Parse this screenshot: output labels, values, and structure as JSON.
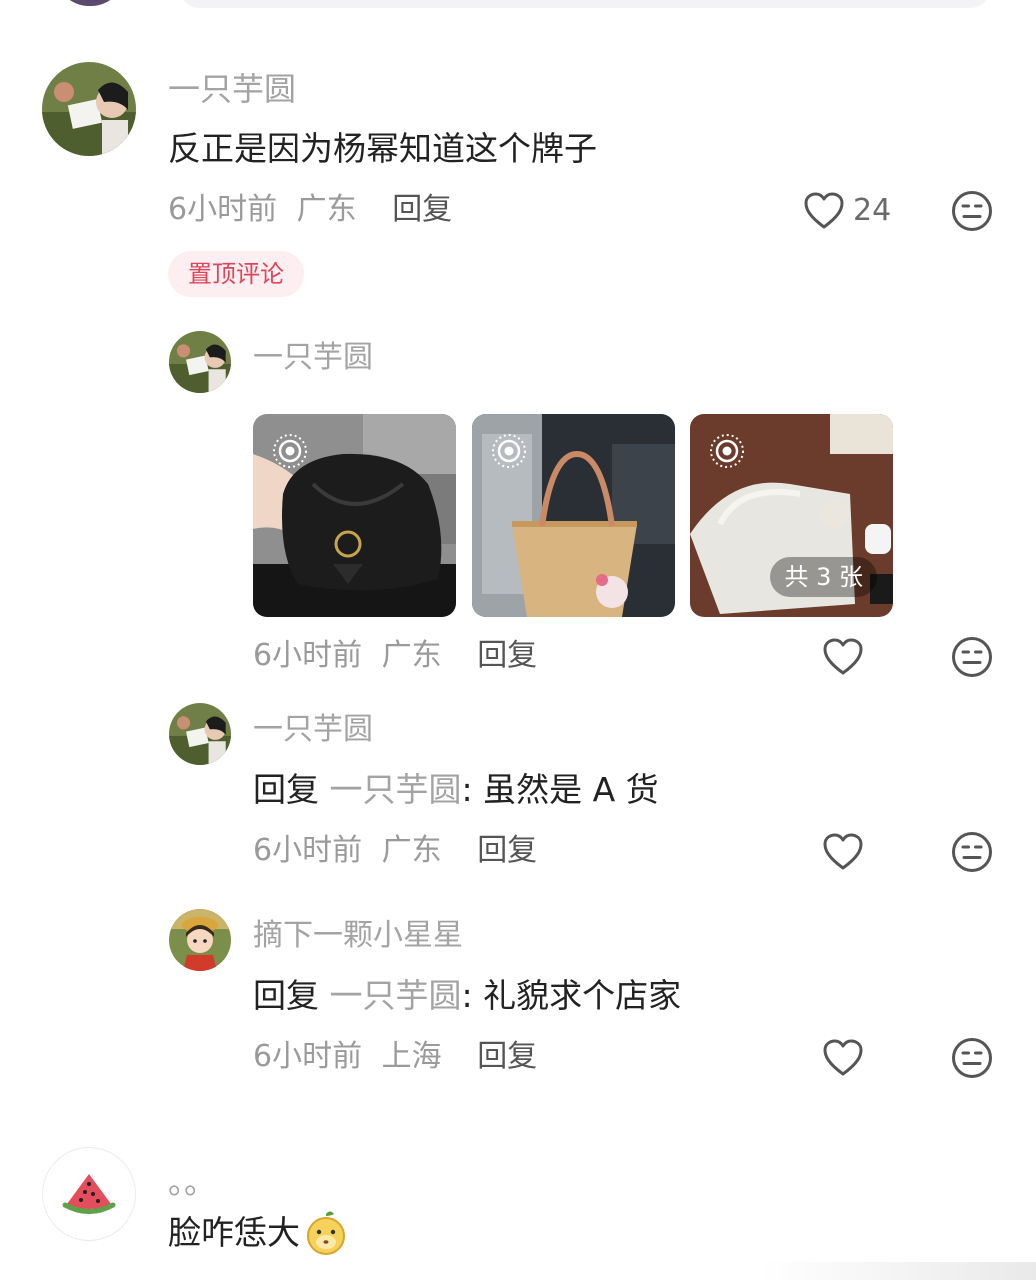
{
  "comments": {
    "main": {
      "username": "一只芋圆",
      "text": "反正是因为杨幂知道这个牌子",
      "time": "6小时前",
      "location": "广东",
      "reply_label": "回复",
      "likes": "24",
      "badge": "置顶评论"
    },
    "replies": [
      {
        "username": "一只芋圆",
        "images_badge": "共 3 张",
        "time": "6小时前",
        "location": "广东",
        "reply_label": "回复"
      },
      {
        "username": "一只芋圆",
        "prefix": "回复",
        "target": "一只芋圆",
        "text": ": 虽然是 A 货",
        "time": "6小时前",
        "location": "广东",
        "reply_label": "回复"
      },
      {
        "username": "摘下一颗小星星",
        "prefix": "回复",
        "target": "一只芋圆",
        "text": ": 礼貌求个店家",
        "time": "6小时前",
        "location": "上海",
        "reply_label": "回复"
      }
    ],
    "next": {
      "username": "。。",
      "text": "脸咋恁大"
    }
  },
  "icons": {
    "like": "heart-outline-icon",
    "dislike": "meh-face-icon",
    "live": "live-photo-icon",
    "avatar_next": "watermelon-icon",
    "emoji": "mango-emoji-icon"
  },
  "colors": {
    "pin_badge_bg": "#fdeff1",
    "pin_badge_text": "#e0455a",
    "muted_text": "#a3a3a3"
  }
}
